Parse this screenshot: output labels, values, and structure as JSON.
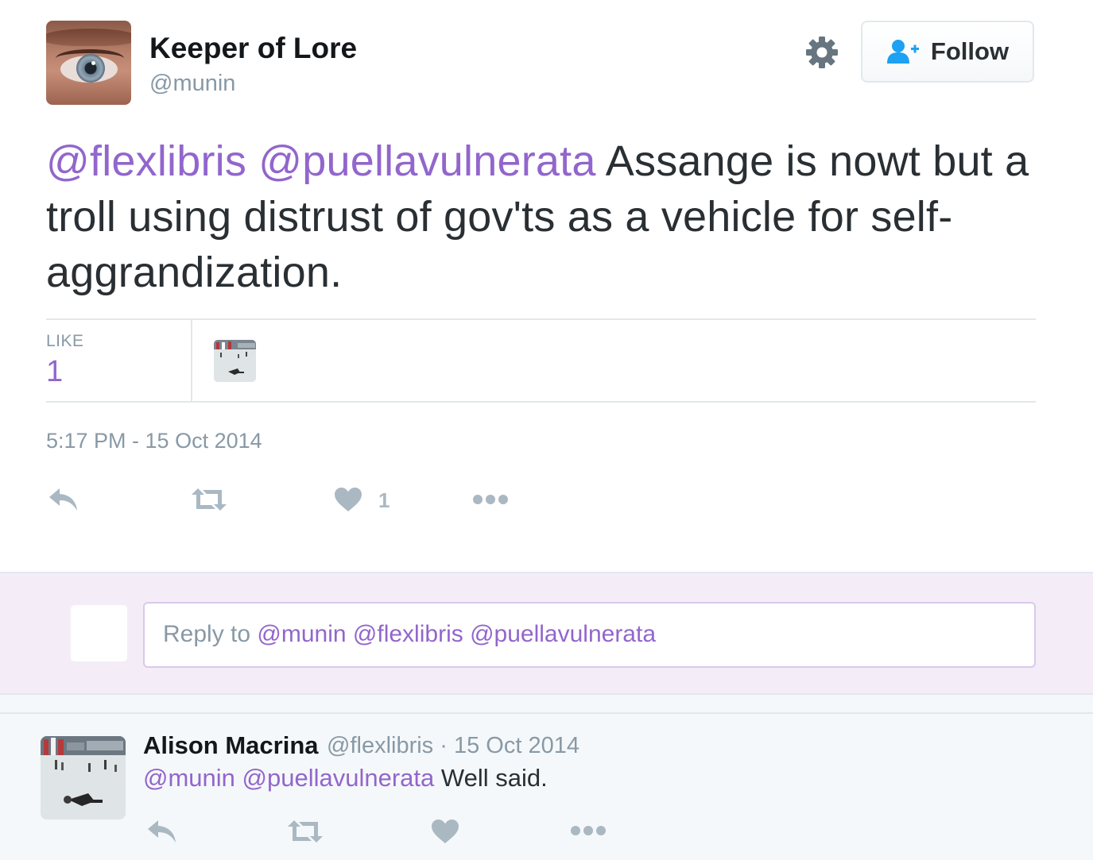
{
  "author": {
    "name": "Keeper of Lore",
    "handle": "@munin"
  },
  "follow_button": {
    "label": "Follow"
  },
  "tweet": {
    "mentions": [
      "@flexlibris",
      "@puellavulnerata"
    ],
    "text": "Assange is nowt but a troll using distrust of gov'ts as a vehicle for self-aggrandization.",
    "timestamp": "5:17 PM - 15 Oct 2014"
  },
  "stats": {
    "like_label": "LIKE",
    "like_count": "1"
  },
  "actions": {
    "like_count": "1"
  },
  "reply_box": {
    "prefix": "Reply to",
    "mentions": [
      "@munin",
      "@flexlibris",
      "@puellavulnerata"
    ]
  },
  "reply_tweet": {
    "name": "Alison Macrina",
    "handle": "@flexlibris",
    "separator": "·",
    "date": "15 Oct 2014",
    "mentions": [
      "@munin",
      "@puellavulnerata"
    ],
    "text": "Well said."
  },
  "colors": {
    "accent": "#9266cc",
    "muted": "#8899a6",
    "icon": "#aab8c2",
    "reply_band": "#f4edf8"
  },
  "icons": [
    "gear-icon",
    "follow-user-icon",
    "reply-icon",
    "retweet-icon",
    "heart-icon",
    "more-icon"
  ]
}
